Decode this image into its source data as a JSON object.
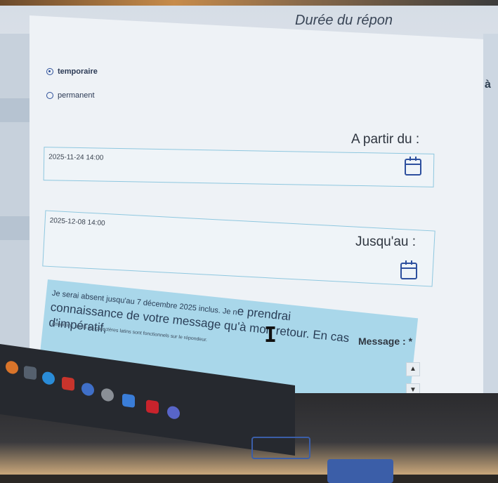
{
  "dialog": {
    "title": "Durée du répon",
    "options": [
      {
        "label": "temporaire",
        "checked": true
      },
      {
        "label": "permanent",
        "checked": false
      }
    ]
  },
  "start": {
    "label": "A partir du :",
    "value": "2025-11-24 14:00",
    "icon": "calendar-icon"
  },
  "end": {
    "label": "Jusqu'au :",
    "value": "2025-12-08 14:00",
    "icon": "calendar-icon"
  },
  "message": {
    "label": "Message :",
    "required_mark": "*",
    "line1": "Je serai absent jusqu'au 7 décembre 2025  inclus. Je n",
    "line2": "connaissance de votre message qu'à mon retour. En cas d'impératif,",
    "line1_end": "e prendrai",
    "note": "Attention : seuls les caractères latins sont fonctionnels sur le répondeur."
  },
  "side": {
    "right_letter": "à"
  },
  "colors": {
    "accent": "#2c4f9a",
    "input_border": "#8ec7df",
    "message_bg": "#a9d7ea"
  }
}
